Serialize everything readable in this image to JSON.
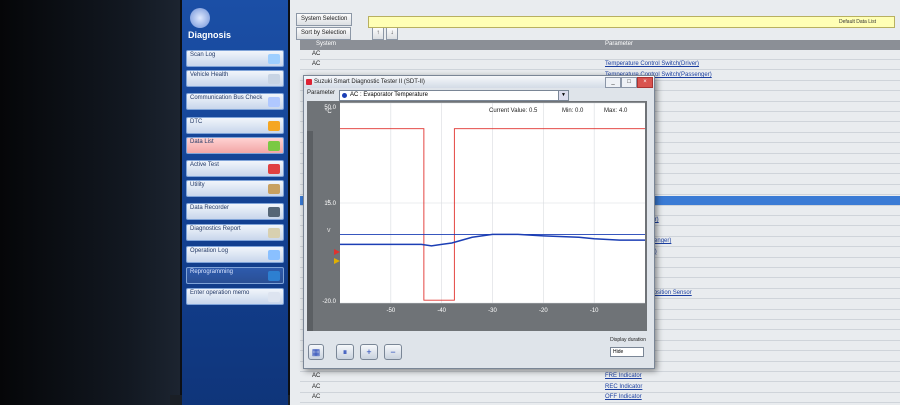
{
  "sidebar": {
    "title": "Diagnosis",
    "items": [
      {
        "label": "Scan Log",
        "icon": "magnifier-icon"
      },
      {
        "label": "Vehicle Health",
        "icon": "stethoscope-icon"
      },
      {
        "label": "Communication Bus Check",
        "icon": "bus-check-icon"
      },
      {
        "label": "DTC",
        "icon": "engine-icon"
      },
      {
        "label": "Data List",
        "icon": "data-list-icon"
      },
      {
        "label": "Active Test",
        "icon": "checklist-icon"
      },
      {
        "label": "Utility",
        "icon": "tools-icon"
      },
      {
        "label": "Data Recorder",
        "icon": "recorder-icon"
      },
      {
        "label": "Diagnostics Report",
        "icon": "report-icon"
      },
      {
        "label": "Operation Log",
        "icon": "log-icon"
      },
      {
        "label": "Reprogramming",
        "icon": "reprogram-icon"
      },
      {
        "label": "Enter operation memo",
        "icon": "memo-icon"
      }
    ]
  },
  "toolbar": {
    "system_selection": "System Selection",
    "sort_by_selection": "Sort by Selection",
    "default_data_list": "Default Data List"
  },
  "grid": {
    "headers": {
      "system": "System",
      "parameter": "Parameter"
    },
    "rows": [
      {
        "system": "AC",
        "parameter": ""
      },
      {
        "system": "AC",
        "parameter": "Temperature Control Switch(Driver)"
      },
      {
        "system": "",
        "parameter": "Temperature Control Switch(Passenger)"
      },
      {
        "system": "",
        "parameter": "tch"
      },
      {
        "system": "",
        "parameter": ""
      },
      {
        "system": "",
        "parameter": ""
      },
      {
        "system": "",
        "parameter": ""
      },
      {
        "system": "",
        "parameter": ""
      },
      {
        "system": "",
        "parameter": ""
      },
      {
        "system": "",
        "parameter": ""
      },
      {
        "system": "",
        "parameter": "rature"
      },
      {
        "system": "",
        "parameter": "e"
      },
      {
        "system": "",
        "parameter": ""
      },
      {
        "system": "",
        "parameter": "nger)"
      },
      {
        "system": "",
        "parameter": "perature"
      },
      {
        "system": "",
        "parameter": "isure"
      },
      {
        "system": "",
        "parameter": "ation Sensor(Driver)"
      },
      {
        "system": "",
        "parameter": "ensor(Driver)"
      },
      {
        "system": "",
        "parameter": "ation Sensor(Passenger)"
      },
      {
        "system": "",
        "parameter": "Sensor(Passenger)"
      },
      {
        "system": "",
        "parameter": "ion Sensor"
      },
      {
        "system": "",
        "parameter": "ensor"
      },
      {
        "system": "",
        "parameter": "ition"
      },
      {
        "system": "",
        "parameter": "Control Actuator Position Sensor"
      },
      {
        "system": "",
        "parameter": ""
      },
      {
        "system": "",
        "parameter": "Position"
      },
      {
        "system": "",
        "parameter": "itor"
      },
      {
        "system": "",
        "parameter": "tor"
      },
      {
        "system": "",
        "parameter": ""
      },
      {
        "system": "",
        "parameter": "Switch"
      },
      {
        "system": "AC",
        "parameter": "A/C Indicator"
      },
      {
        "system": "AC",
        "parameter": "FRE Indicator"
      },
      {
        "system": "AC",
        "parameter": "REC Indicator"
      },
      {
        "system": "AC",
        "parameter": "OFF Indicator"
      }
    ]
  },
  "window": {
    "title": "Suzuki Smart Diagnostic Tester II (SDT-II)",
    "parameter_label": "Parameter",
    "parameter_value": "AC : Evaporator Temperature",
    "current_value_label": "Current Value:",
    "current_value": "0.5",
    "min_label": "Min:",
    "min_value": "0.0",
    "max_label": "Max:",
    "max_value": "4.0",
    "unit": "°C",
    "display_duration_label": "Display duration",
    "display_duration_value": "Hide"
  },
  "colors": {
    "sidebar": "#1b4fa6",
    "selected_row": "#3a7bd5",
    "series_red": "#e0322e",
    "series_blue": "#1c3fb5"
  },
  "chart_data": {
    "type": "line",
    "y_ticks": [
      "50.0",
      "15.0",
      "-20.0"
    ],
    "x_ticks": [
      "-50",
      "-40",
      "-30",
      "-20",
      "-10"
    ],
    "ylim": [
      -20,
      50
    ],
    "xlim": [
      -60,
      0
    ],
    "grid": true,
    "series": [
      {
        "color": "#e0322e",
        "x": [
          -60,
          -43.5,
          -43.5,
          -37.5,
          -37.5,
          0
        ],
        "y": [
          41,
          41,
          -19,
          -19,
          41,
          41
        ]
      },
      {
        "color": "#1c3fb5",
        "x": [
          -60,
          -44,
          -42,
          -40,
          -38,
          -36,
          -34,
          -30,
          -25,
          -20,
          -13,
          -10,
          -5,
          0
        ],
        "y": [
          0.5,
          0.5,
          0,
          0.5,
          1,
          2,
          3,
          4,
          4,
          3.5,
          3,
          2.5,
          2,
          2
        ]
      },
      {
        "color": "#1c3fb5",
        "x": [
          -60,
          0
        ],
        "y": [
          4,
          4
        ]
      }
    ]
  }
}
